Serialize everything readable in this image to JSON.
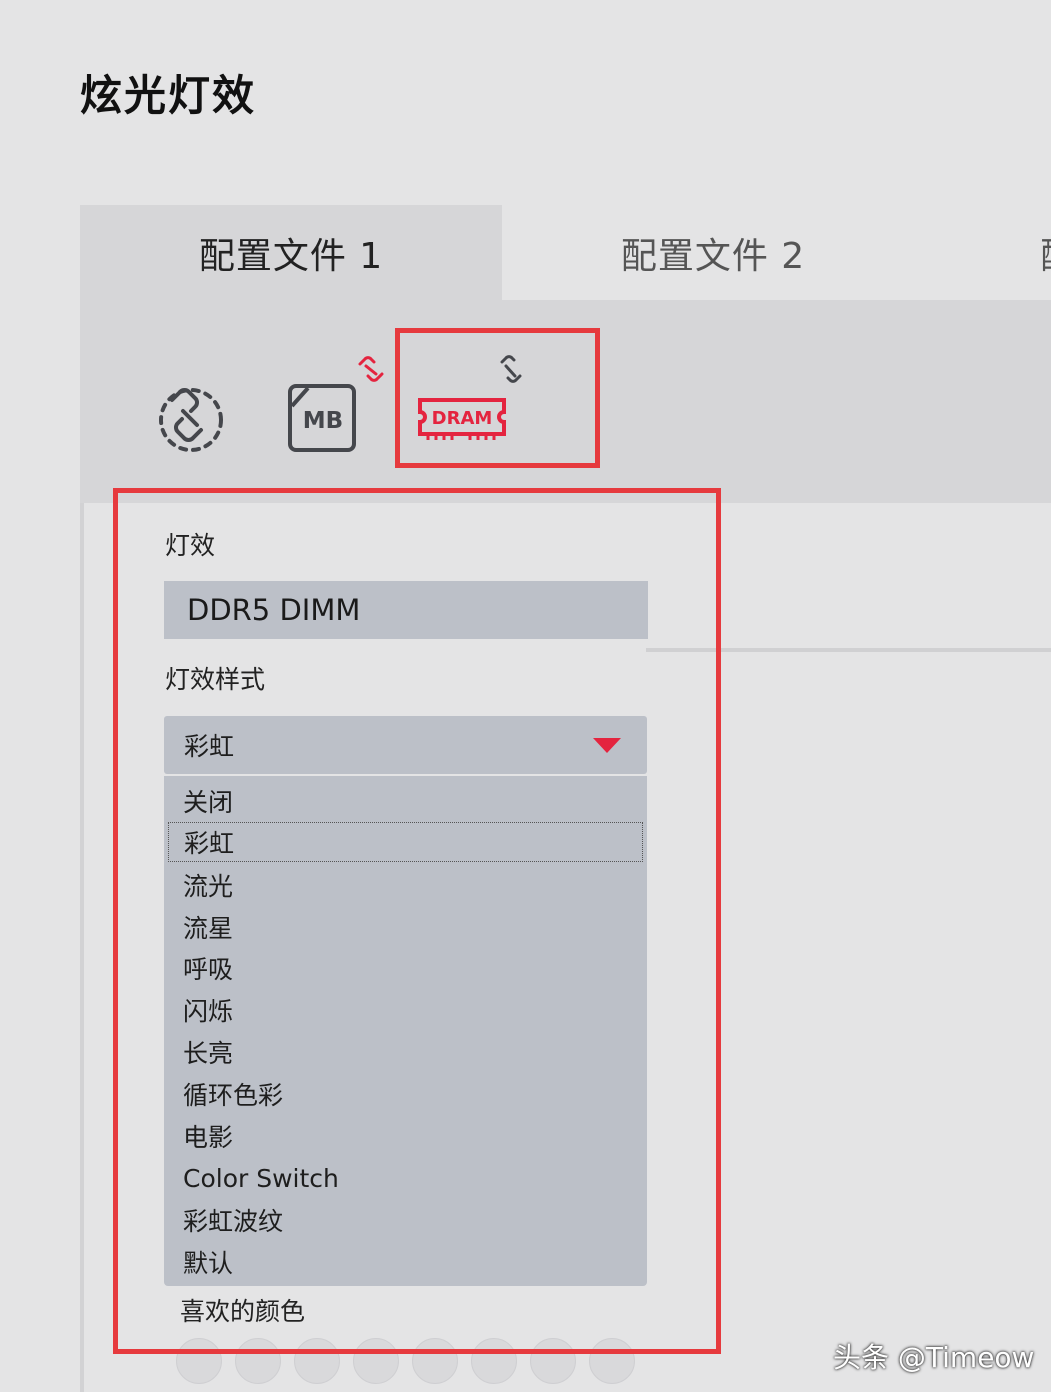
{
  "page_title": "炫光灯效",
  "tabs": [
    {
      "label": "配置文件 1",
      "active": true
    },
    {
      "label": "配置文件 2",
      "active": false
    },
    {
      "label": "配",
      "active": false
    }
  ],
  "devices": {
    "mb_label": "MB",
    "dram_label": "DRAM",
    "accent_color": "#e4243f"
  },
  "effect": {
    "label": "灯效",
    "device_value": "DDR5 DIMM"
  },
  "style": {
    "label": "灯效样式",
    "selected": "彩虹",
    "options": [
      "关闭",
      "彩虹",
      "流光",
      "流星",
      "呼吸",
      "闪烁",
      "长亮",
      "循环色彩",
      "电影",
      "Color Switch",
      "彩虹波纹",
      "默认"
    ]
  },
  "favorite_colors": {
    "label": "喜欢的颜色"
  },
  "watermark": "头条 @Timeow",
  "highlight_color": "#e63a3e"
}
